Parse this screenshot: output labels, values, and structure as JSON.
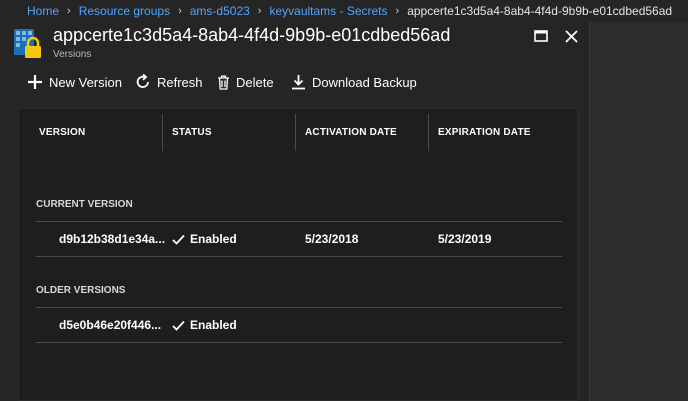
{
  "breadcrumb": {
    "items": [
      {
        "label": "Home"
      },
      {
        "label": "Resource groups"
      },
      {
        "label": "ams-d5023"
      },
      {
        "label": "keyvaultams - Secrets"
      }
    ],
    "current": "appcerte1c3d5a4-8ab4-4f4d-9b9b-e01cdbed56ad"
  },
  "blade": {
    "title": "appcerte1c3d5a4-8ab4-4f4d-9b9b-e01cdbed56ad",
    "subtitle": "Versions"
  },
  "toolbar": {
    "new_version": "New Version",
    "refresh": "Refresh",
    "delete": "Delete",
    "download_backup": "Download Backup"
  },
  "table": {
    "headers": {
      "version": "VERSION",
      "status": "STATUS",
      "activation": "ACTIVATION DATE",
      "expiration": "EXPIRATION DATE"
    },
    "current_section": "CURRENT VERSION",
    "older_section": "OLDER VERSIONS",
    "current_rows": [
      {
        "version": "d9b12b38d1e34a...",
        "status": "Enabled",
        "activation": "5/23/2018",
        "expiration": "5/23/2019"
      }
    ],
    "older_rows": [
      {
        "version": "d5e0b46e20f446...",
        "status": "Enabled",
        "activation": "",
        "expiration": ""
      }
    ]
  },
  "colors": {
    "link": "#4fa6ff",
    "panel": "#252526",
    "content": "#1e1e1e",
    "key_icon": "#f2c811"
  }
}
